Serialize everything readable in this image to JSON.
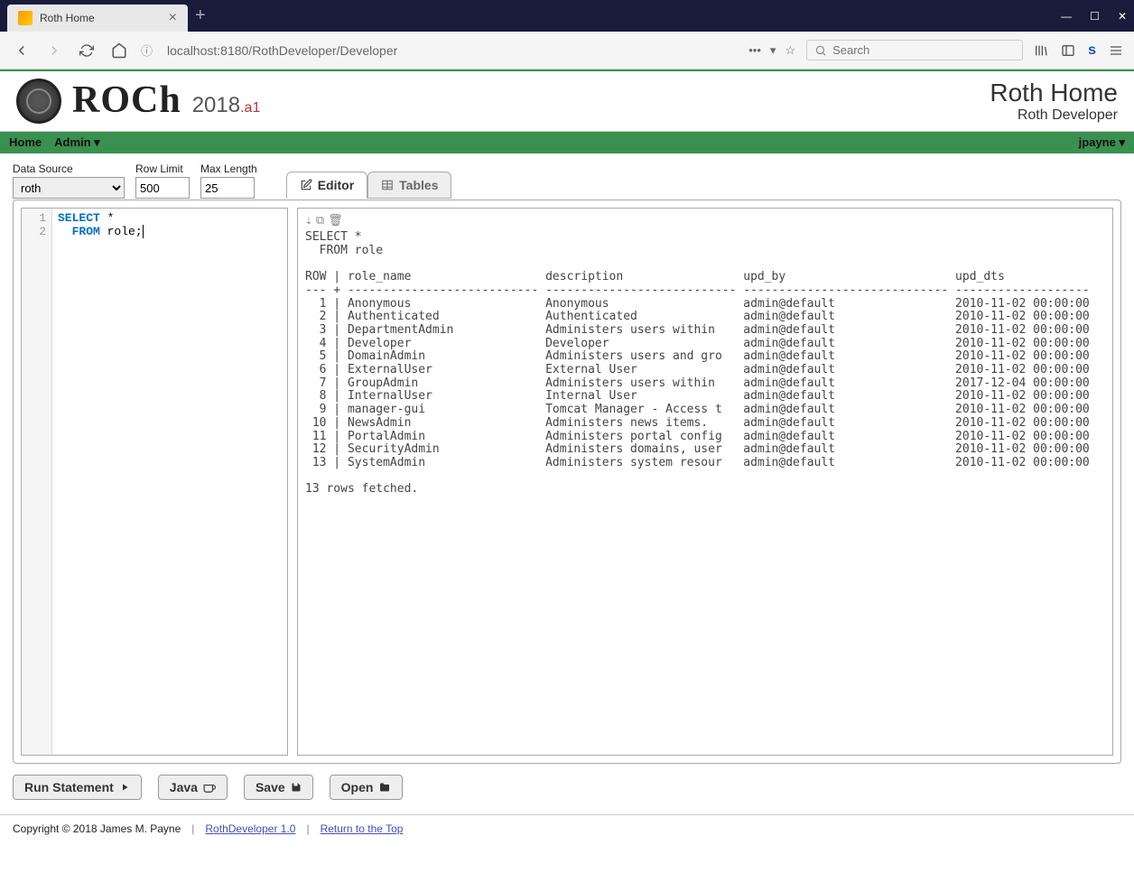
{
  "browser": {
    "tab_title": "Roth Home",
    "url": "localhost:8180/RothDeveloper/Developer",
    "search_placeholder": "Search"
  },
  "header": {
    "logo_text": "ROCh",
    "year": "2018",
    "suffix": ".a1",
    "title": "Roth Home",
    "subtitle": "Roth Developer"
  },
  "menu": {
    "home": "Home",
    "admin": "Admin ▾",
    "user": "jpayne ▾"
  },
  "toolbar": {
    "data_source_label": "Data Source",
    "data_source_value": "roth",
    "row_limit_label": "Row Limit",
    "row_limit_value": "500",
    "max_length_label": "Max Length",
    "max_length_value": "25"
  },
  "tabs": {
    "editor": "Editor",
    "tables": "Tables"
  },
  "editor": {
    "line1_kw": "SELECT",
    "line1_rest": " *",
    "line2_kw": "FROM",
    "line2_pre": "  ",
    "line2_rest": " role;"
  },
  "results": {
    "query": "SELECT *\n  FROM role",
    "header": "ROW | role_name                   description                 upd_by                        upd_dts",
    "divider": "--- + --------------------------- --------------------------- ----------------------------- -------------------",
    "rows": [
      "  1 | Anonymous                   Anonymous                   admin@default                 2010-11-02 00:00:00",
      "  2 | Authenticated               Authenticated               admin@default                 2010-11-02 00:00:00",
      "  3 | DepartmentAdmin             Administers users within    admin@default                 2010-11-02 00:00:00",
      "  4 | Developer                   Developer                   admin@default                 2010-11-02 00:00:00",
      "  5 | DomainAdmin                 Administers users and gro   admin@default                 2010-11-02 00:00:00",
      "  6 | ExternalUser                External User               admin@default                 2010-11-02 00:00:00",
      "  7 | GroupAdmin                  Administers users within    admin@default                 2017-12-04 00:00:00",
      "  8 | InternalUser                Internal User               admin@default                 2010-11-02 00:00:00",
      "  9 | manager-gui                 Tomcat Manager - Access t   admin@default                 2010-11-02 00:00:00",
      " 10 | NewsAdmin                   Administers news items.     admin@default                 2010-11-02 00:00:00",
      " 11 | PortalAdmin                 Administers portal config   admin@default                 2010-11-02 00:00:00",
      " 12 | SecurityAdmin               Administers domains, user   admin@default                 2010-11-02 00:00:00",
      " 13 | SystemAdmin                 Administers system resour   admin@default                 2010-11-02 00:00:00"
    ],
    "footer": "13 rows fetched."
  },
  "buttons": {
    "run": "Run Statement",
    "java": "Java",
    "save": "Save",
    "open": "Open"
  },
  "footer": {
    "copyright": "Copyright © 2018 James M. Payne",
    "link1": "RothDeveloper 1.0",
    "link2": "Return to the Top"
  }
}
